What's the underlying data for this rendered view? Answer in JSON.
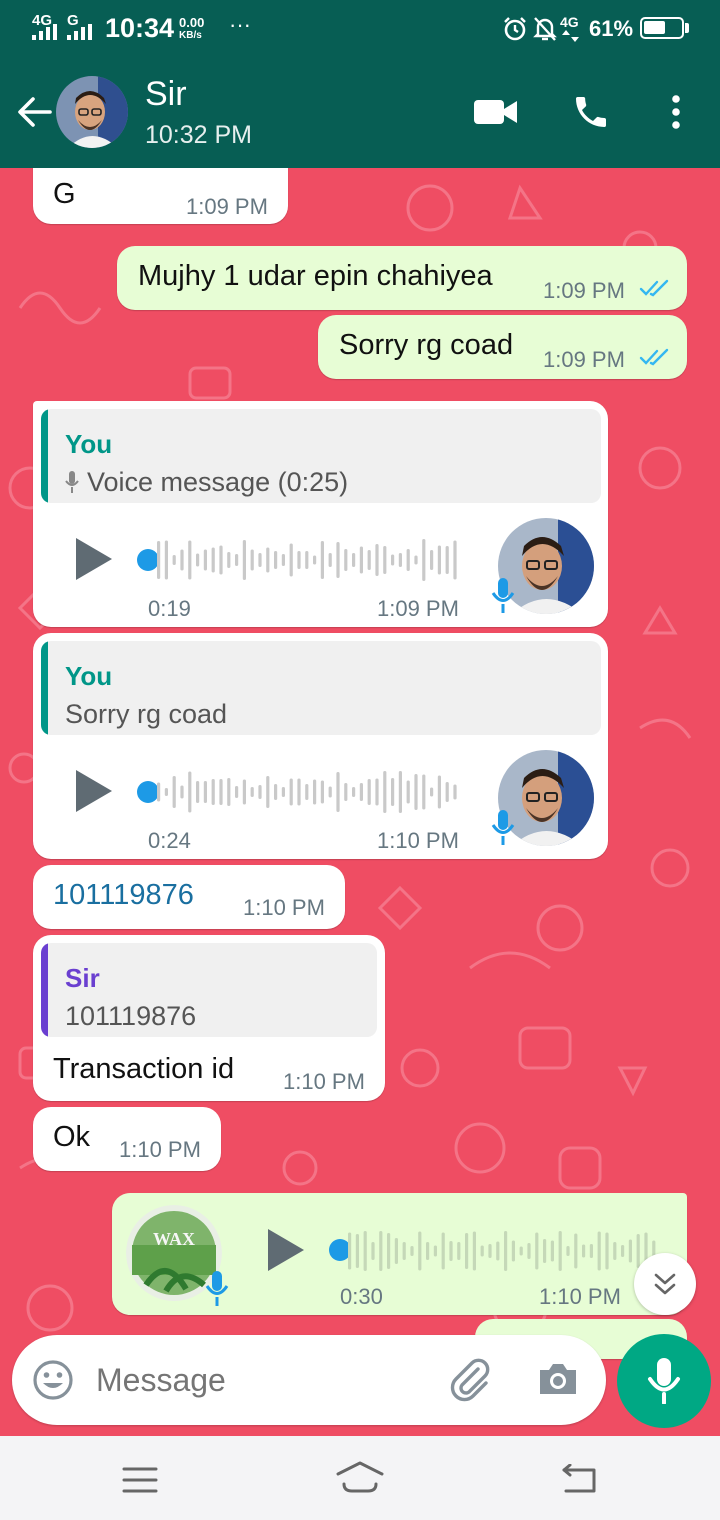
{
  "status": {
    "net1": "4G",
    "net2": "G",
    "time": "10:34",
    "speed_value": "0.00",
    "speed_unit": "KB/s",
    "more": "···",
    "net3": "4G",
    "battery_percent": "61%",
    "battery_level": 0.61
  },
  "header": {
    "contact_name": "Sir",
    "last_seen": "10:32 PM"
  },
  "messages": {
    "m1": {
      "text": "G",
      "time": "1:09 PM"
    },
    "m2": {
      "text": "Mujhy 1 udar epin chahiyea",
      "time": "1:09 PM"
    },
    "m3": {
      "text": "Sorry rg coad",
      "time": "1:09 PM"
    },
    "m4": {
      "quote_author": "You",
      "quote_text": "Voice message (0:25)",
      "duration": "0:19",
      "time": "1:09 PM"
    },
    "m5": {
      "quote_author": "You",
      "quote_text": "Sorry rg coad",
      "duration": "0:24",
      "time": "1:10 PM"
    },
    "m6": {
      "text": "101119876",
      "time": "1:10 PM"
    },
    "m7": {
      "quote_author": "Sir",
      "quote_text": "101119876",
      "text": "Transaction id",
      "time": "1:10 PM"
    },
    "m8": {
      "text": "Ok",
      "time": "1:10 PM"
    },
    "m9": {
      "duration": "0:30",
      "time": "1:10 PM",
      "thumb_label": "WAX"
    }
  },
  "composer": {
    "placeholder": "Message"
  },
  "colors": {
    "header": "#075e54",
    "chat_bg": "#ef4d63",
    "outgoing": "#e7fdd5",
    "incoming": "#ffffff",
    "quote_you": "#009688",
    "quote_sir": "#6a3fd0",
    "link": "#1a6fa0",
    "read_ticks": "#34b7f1",
    "fab": "#00a884"
  },
  "icons": [
    "back-arrow-icon",
    "video-call-icon",
    "phone-icon",
    "more-vert-icon",
    "emoji-icon",
    "attach-icon",
    "camera-icon",
    "mic-icon",
    "play-icon",
    "double-check-icon",
    "scroll-down-icon",
    "menu-icon",
    "home-icon",
    "return-icon"
  ]
}
